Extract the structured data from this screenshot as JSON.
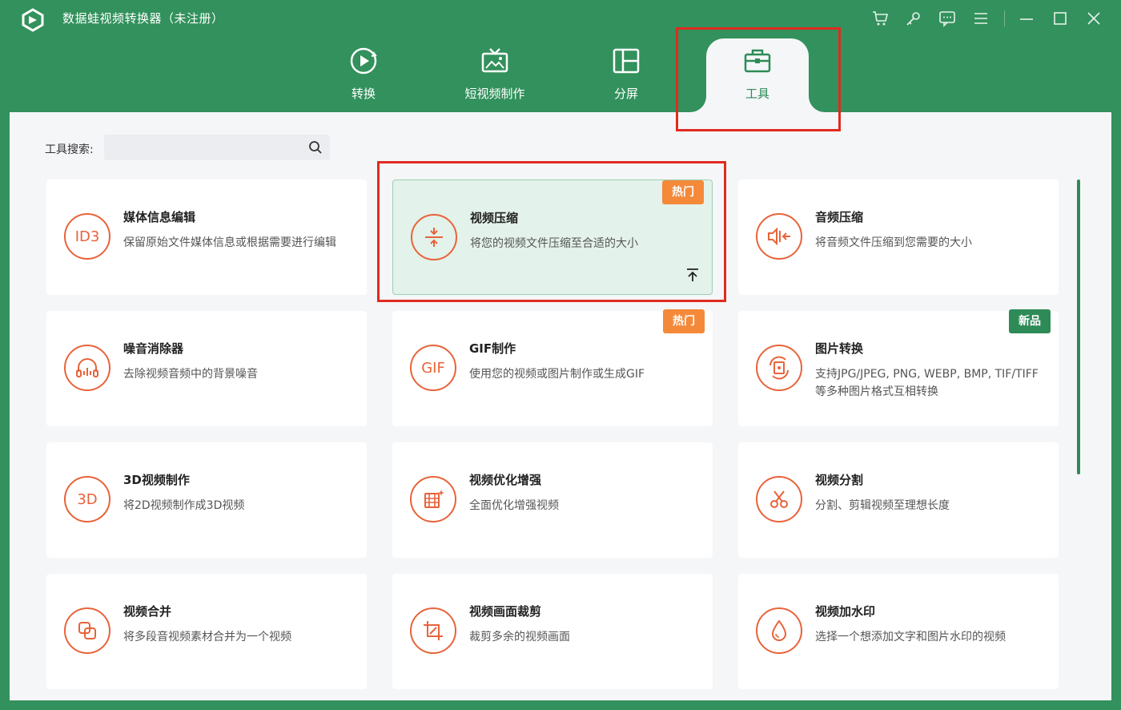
{
  "window": {
    "title": "数据蛙视频转换器（未注册）"
  },
  "tabs": [
    {
      "label": "转换"
    },
    {
      "label": "短视频制作"
    },
    {
      "label": "分屏"
    },
    {
      "label": "工具"
    }
  ],
  "active_tab": "工具",
  "search": {
    "label": "工具搜索:",
    "value": "",
    "placeholder": ""
  },
  "tools": [
    {
      "title": "媒体信息编辑",
      "desc": "保留原始文件媒体信息或根据需要进行编辑",
      "icon": "id3-icon",
      "icon_text": "ID3"
    },
    {
      "title": "视频压缩",
      "desc": "将您的视频文件压缩至合适的大小",
      "icon": "compress-icon",
      "badge": "热门"
    },
    {
      "title": "音频压缩",
      "desc": "将音频文件压缩到您需要的大小",
      "icon": "audio-compress-icon"
    },
    {
      "title": "噪音消除器",
      "desc": "去除视频音频中的背景噪音",
      "icon": "headphones-icon"
    },
    {
      "title": "GIF制作",
      "desc": "使用您的视频或图片制作或生成GIF",
      "icon": "gif-icon",
      "icon_text": "GIF",
      "badge": "热门"
    },
    {
      "title": "图片转换",
      "desc": "支持JPG/JPEG, PNG, WEBP, BMP, TIF/TIFF等多种图片格式互相转换",
      "icon": "image-convert-icon",
      "badge": "新品"
    },
    {
      "title": "3D视频制作",
      "desc": "将2D视频制作成3D视频",
      "icon": "3d-icon",
      "icon_text": "3D"
    },
    {
      "title": "视频优化增强",
      "desc": "全面优化增强视频",
      "icon": "enhance-icon"
    },
    {
      "title": "视频分割",
      "desc": "分割、剪辑视频至理想长度",
      "icon": "scissors-icon"
    },
    {
      "title": "视频合并",
      "desc": "将多段音视频素材合并为一个视频",
      "icon": "merge-icon"
    },
    {
      "title": "视频画面裁剪",
      "desc": "裁剪多余的视频画面",
      "icon": "crop-icon"
    },
    {
      "title": "视频加水印",
      "desc": "选择一个想添加文字和图片水印的视频",
      "icon": "watermark-icon"
    }
  ],
  "colors": {
    "brand_green": "#2e8b57",
    "accent_orange": "#e8633a",
    "hot_badge": "#f5893a",
    "highlight_red": "#e02b20"
  }
}
